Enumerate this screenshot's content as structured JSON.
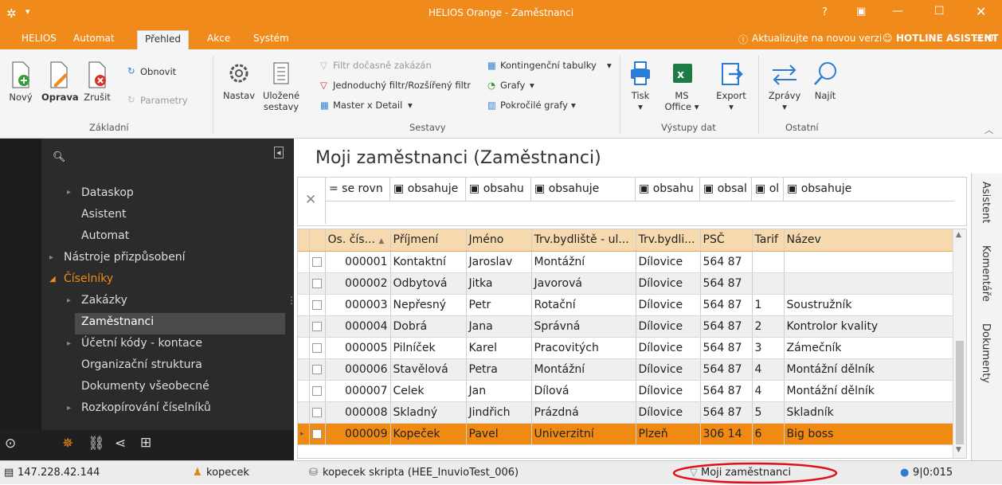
{
  "window": {
    "title": "HELIOS Orange - Zaměstnanci"
  },
  "menu": {
    "items": [
      "HELIOS",
      "Automat",
      "Přehled",
      "Akce",
      "Systém"
    ],
    "update_notice": "Aktualizujte na novou verzi",
    "hotline": "HOTLINE ASISTENT",
    "hotline_count": "0"
  },
  "ribbon": {
    "zakladni": {
      "novy": "Nový",
      "oprava": "Oprava",
      "zrusit": "Zrušit",
      "obnovit": "Obnovit",
      "parametry": "Parametry",
      "group": "Základní"
    },
    "sestavy": {
      "nastav": "Nastav",
      "ulozene1": "Uložené",
      "ulozene2": "sestavy",
      "filtr": "Filtr dočasně zakázán",
      "jednoduchy": "Jednoduchý filtr/Rozšířený filtr",
      "master": "Master x Detail",
      "kontingencni": "Kontingenční tabulky",
      "grafy": "Grafy",
      "pokrocile": "Pokročilé grafy",
      "group": "Sestavy"
    },
    "vystupy": {
      "tisk": "Tisk",
      "ms1": "MS",
      "ms2": "Office",
      "export": "Export",
      "group": "Výstupy dat"
    },
    "ostatni": {
      "zpravy": "Zprávy",
      "najit": "Najít",
      "group": "Ostatní"
    }
  },
  "sidebar": {
    "items": [
      "Dataskop",
      "Asistent",
      "Automat",
      "Nástroje přizpůsobení",
      "Číselníky",
      "Zakázky",
      "Zaměstnanci",
      "Účetní kódy - kontace",
      "Organizační struktura",
      "Dokumenty všeobecné",
      "Rozkopírování číselníků"
    ]
  },
  "main": {
    "title": "Moji zaměstnanci (Zaměstnanci)",
    "filters": [
      "= se rovn",
      "obsahuje",
      "obsahu",
      "obsahuje",
      "obsahu",
      "obsal",
      "ol",
      "obsahuje"
    ],
    "columns": [
      "Os. čís...",
      "Příjmení",
      "Jméno",
      "Trv.bydliště - ul...",
      "Trv.bydli...",
      "PSČ",
      "Tarif",
      "Název"
    ],
    "rows": [
      [
        "000001",
        "Kontaktní",
        "Jaroslav",
        "Montážní",
        "Dílovice",
        "564 87",
        "",
        ""
      ],
      [
        "000002",
        "Odbytová",
        "Jitka",
        "Javorová",
        "Dílovice",
        "564 87",
        "",
        ""
      ],
      [
        "000003",
        "Nepřesný",
        "Petr",
        "Rotační",
        "Dílovice",
        "564 87",
        "1",
        "Soustružník"
      ],
      [
        "000004",
        "Dobrá",
        "Jana",
        "Správná",
        "Dílovice",
        "564 87",
        "2",
        "Kontrolor kvality"
      ],
      [
        "000005",
        "Pilníček",
        "Karel",
        "Pracovitých",
        "Dílovice",
        "564 87",
        "3",
        "Zámečník"
      ],
      [
        "000006",
        "Stavělová",
        "Petra",
        "Montážní",
        "Dílovice",
        "564 87",
        "4",
        "Montážní dělník"
      ],
      [
        "000007",
        "Celek",
        "Jan",
        "Dílová",
        "Dílovice",
        "564 87",
        "4",
        "Montážní dělník"
      ],
      [
        "000008",
        "Skladný",
        "Jindřich",
        "Prázdná",
        "Dílovice",
        "564 87",
        "5",
        "Skladník"
      ],
      [
        "000009",
        "Kopeček",
        "Pavel",
        "Univerzitní",
        "Plzeň",
        "306 14",
        "6",
        "Big boss"
      ]
    ],
    "right_tabs": [
      "Asistent",
      "Komentáře",
      "Dokumenty"
    ]
  },
  "status": {
    "ip": "147.228.42.144",
    "user": "kopecek",
    "db": "kopecek skripta (HEE_InuvioTest_006)",
    "filter": "Moji zaměstnanci",
    "info": "9|0:015"
  },
  "colors": {
    "accent": "#f08a1a",
    "selected_row": "#f18a12",
    "sidebar": "#2b2b2b",
    "highlight_oval": "#e0101c"
  }
}
